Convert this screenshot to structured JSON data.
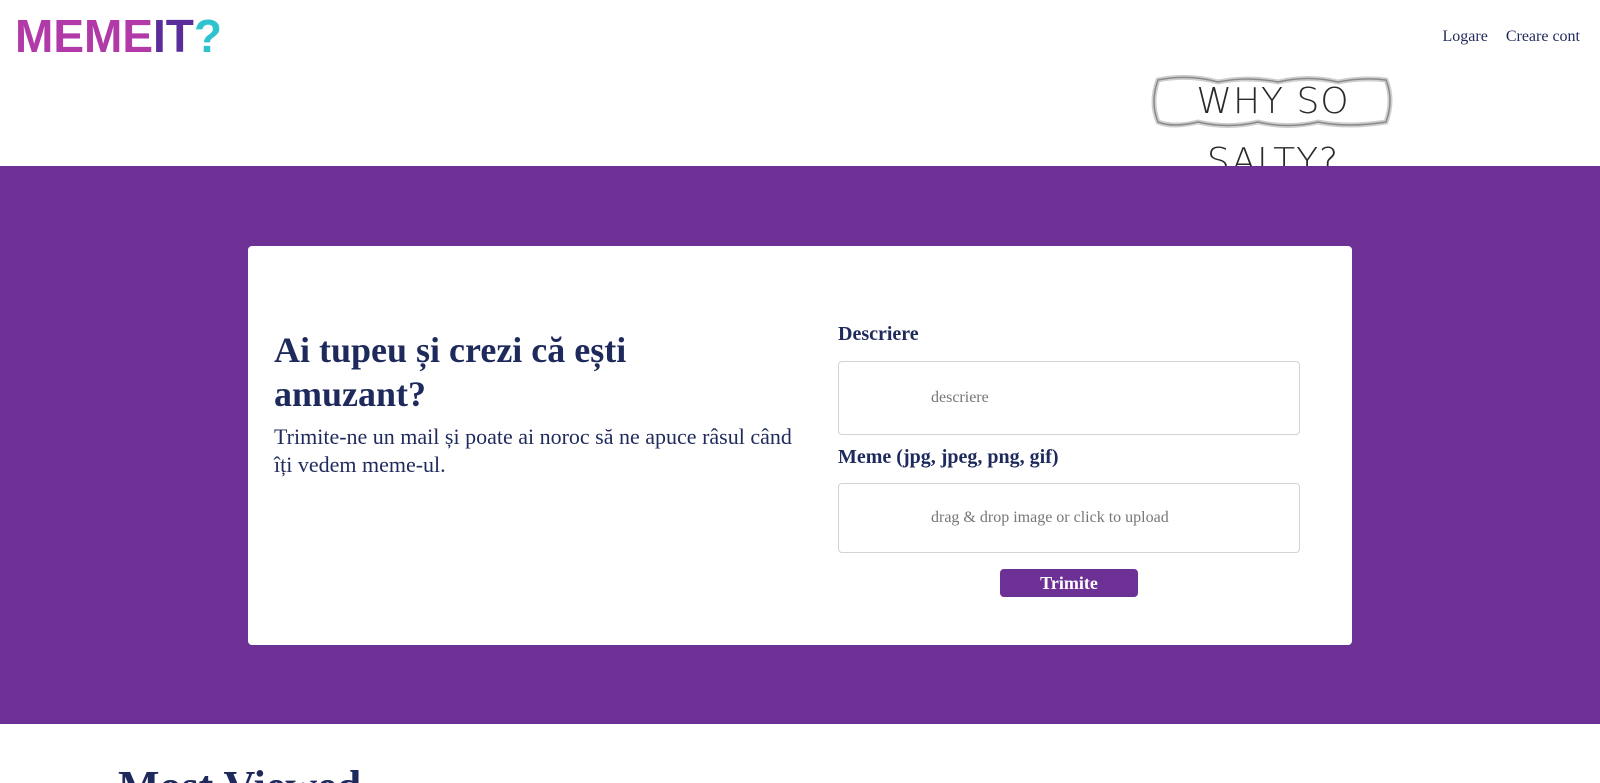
{
  "header": {
    "logo": {
      "part1": "MEME",
      "part2": "IT",
      "part3": "?"
    },
    "nav": {
      "login": "Logare",
      "signup": "Creare cont"
    },
    "banner_text": "WHY SO SALTY?"
  },
  "hero": {
    "title": "Ai tupeu și crezi că ești amuzant?",
    "lead": "Trimite-ne un mail și poate ai noroc să ne apuce râsul când îți vedem meme-ul."
  },
  "form": {
    "description_label": "Descriere",
    "description_placeholder": "descriere",
    "meme_label": "Meme (jpg, jpeg, png, gif)",
    "upload_text": "drag & drop image or click to upload",
    "submit_label": "Trimite"
  },
  "section": {
    "title": "Most Viewed"
  },
  "colors": {
    "purple": "#6d3094",
    "navy": "#1f2a5c",
    "logo_magenta": "#b13aa8",
    "logo_cyan": "#2fc3cf"
  }
}
